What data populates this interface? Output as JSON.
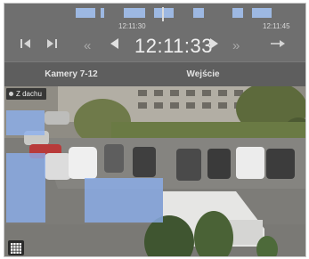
{
  "timeline": {
    "time_left": "12:11:30",
    "time_right": "12:11:45"
  },
  "controls": {
    "current_time": "12:11:33",
    "icons": [
      "skip-to-start-icon",
      "skip-to-end-icon",
      "rewind-icon",
      "step-back-icon",
      "step-forward-icon",
      "fast-forward-icon",
      "jump-to-live-icon"
    ]
  },
  "tabs": [
    {
      "label": "Kamery 7-12"
    },
    {
      "label": "Wejście"
    }
  ],
  "camera": {
    "name": "Z dachu",
    "status_color": "#d0d0d0",
    "motion_color": "#8cafef"
  }
}
